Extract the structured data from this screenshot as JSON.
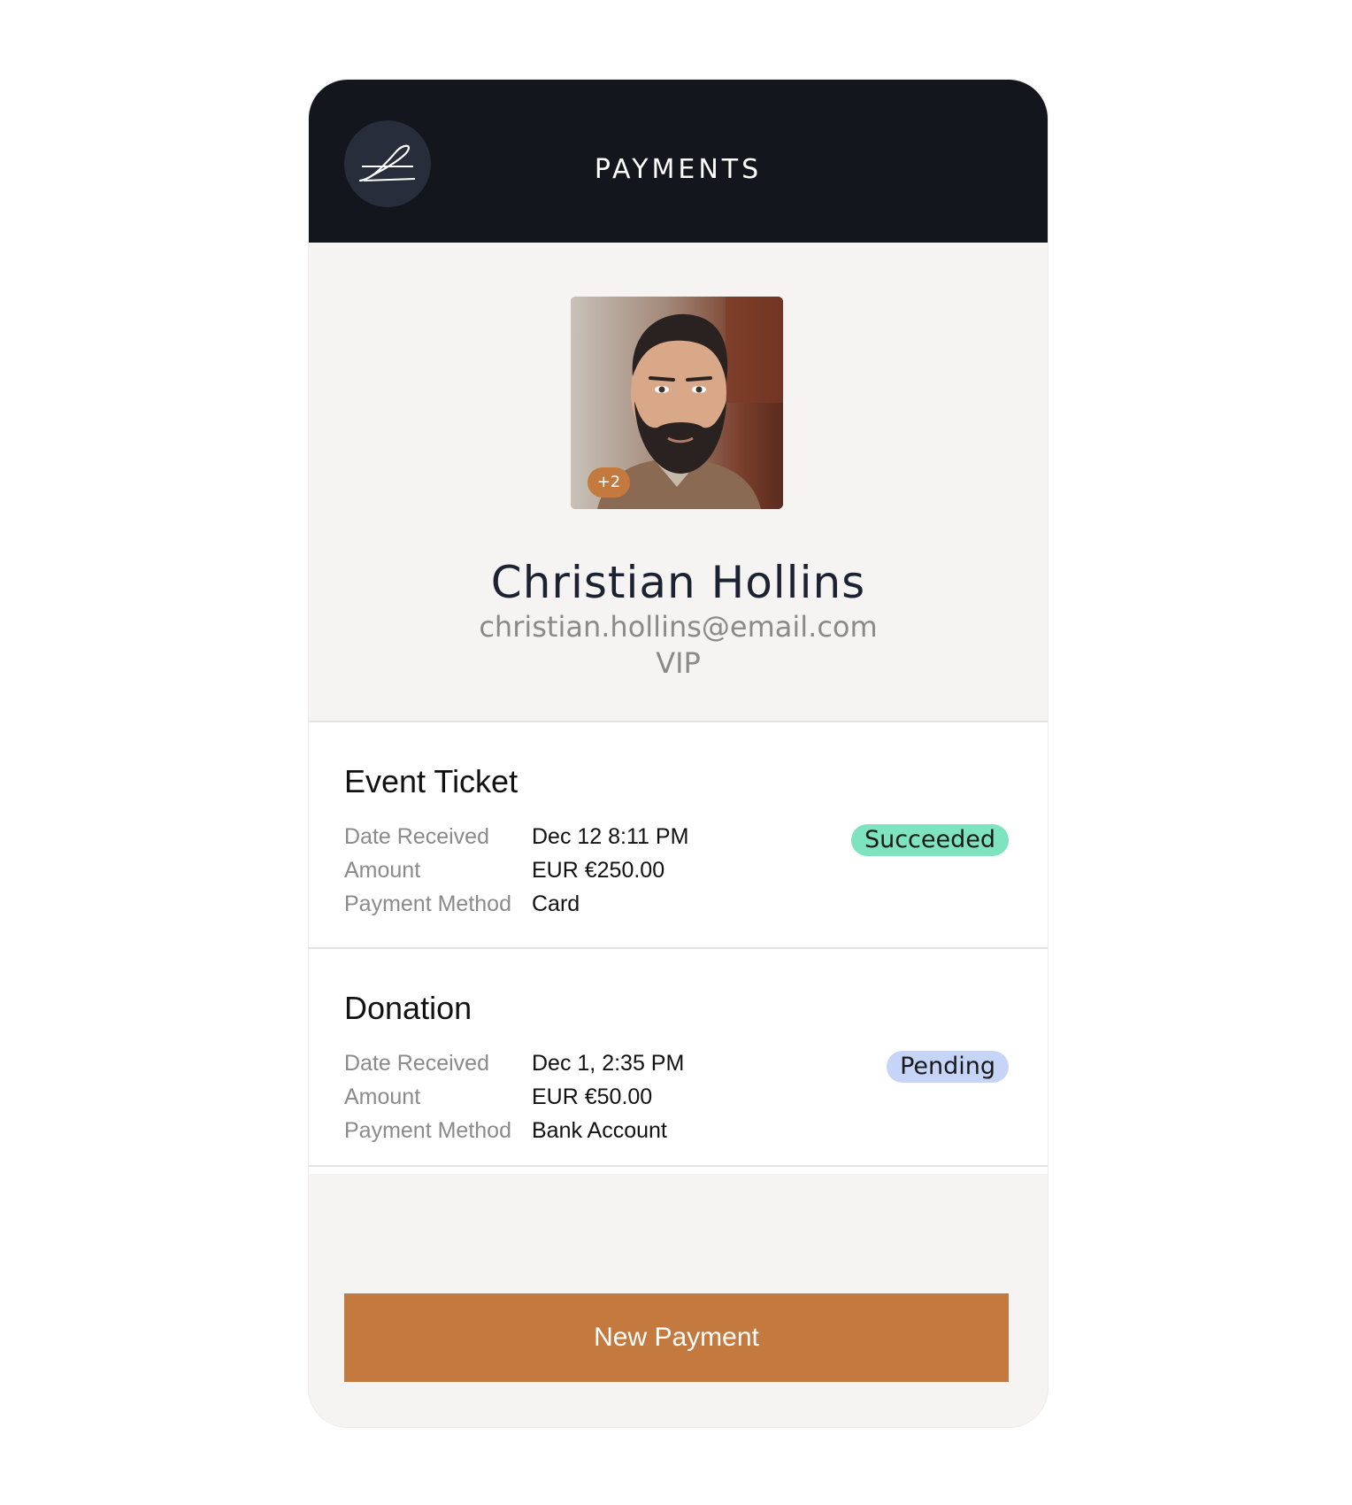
{
  "header": {
    "title": "PAYMENTS",
    "logo_icon": "signature-icon"
  },
  "profile": {
    "avatar_badge": "+2",
    "name": "Christian Hollins",
    "email": "christian.hollins@email.com",
    "tier": "VIP"
  },
  "payments": [
    {
      "title": "Event Ticket",
      "rows": [
        {
          "label": "Date Received",
          "value": "Dec 12 8:11 PM"
        },
        {
          "label": "Amount",
          "value": "EUR €250.00"
        },
        {
          "label": "Payment Method",
          "value": "Card"
        }
      ],
      "status": "Succeeded",
      "status_color": "#7ee3bf"
    },
    {
      "title": "Donation",
      "rows": [
        {
          "label": "Date Received",
          "value": "Dec 1, 2:35 PM"
        },
        {
          "label": "Amount",
          "value": "EUR €50.00"
        },
        {
          "label": "Payment Method",
          "value": "Bank Account"
        }
      ],
      "status": "Pending",
      "status_color": "#c5d4f7"
    }
  ],
  "actions": {
    "new_payment_label": "New Payment"
  },
  "colors": {
    "header_bg": "#13161d",
    "accent": "#c47a3e",
    "background": "#f5f4f2"
  }
}
